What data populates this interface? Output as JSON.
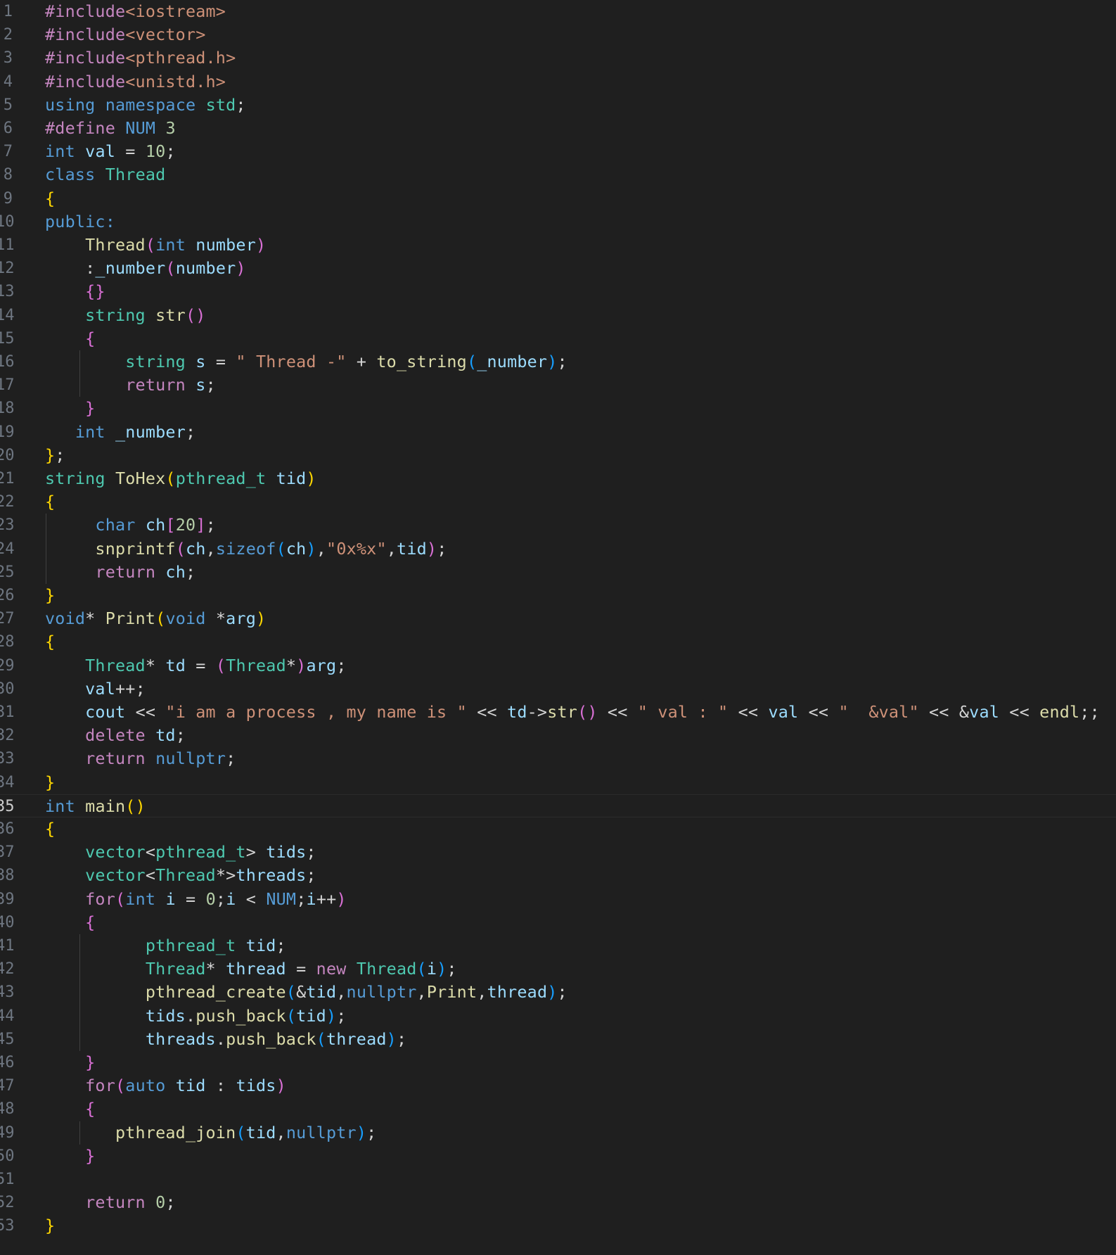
{
  "editor": {
    "theme_colors": {
      "background": "#1f1f1f",
      "preprocessor": "#c586c0",
      "keyword": "#569cd6",
      "control": "#c586c0",
      "type": "#4ec9b0",
      "function": "#dcdcaa",
      "variable": "#9cdcfe",
      "string": "#ce9178",
      "number": "#b5cea8",
      "operator": "#d4d4d4",
      "bracket_level1": "#ffd700",
      "bracket_level2": "#da70d6",
      "bracket_level3": "#179fff"
    },
    "current_line": 35,
    "line_numbers": [
      "1",
      "2",
      "3",
      "4",
      "5",
      "6",
      "7",
      "8",
      "9",
      "10",
      "11",
      "12",
      "13",
      "14",
      "15",
      "16",
      "17",
      "18",
      "19",
      "20",
      "21",
      "22",
      "23",
      "24",
      "25",
      "26",
      "27",
      "28",
      "29",
      "30",
      "31",
      "32",
      "33",
      "34",
      "35",
      "36",
      "37",
      "38",
      "39",
      "40",
      "41",
      "42",
      "43",
      "44",
      "45",
      "46",
      "47",
      "48",
      "49",
      "50",
      "51",
      "52",
      "53"
    ],
    "lines": [
      [
        [
          "pp",
          "#include"
        ],
        [
          "str",
          "<iostream>"
        ]
      ],
      [
        [
          "pp",
          "#include"
        ],
        [
          "str",
          "<vector>"
        ]
      ],
      [
        [
          "pp",
          "#include"
        ],
        [
          "str",
          "<pthread.h>"
        ]
      ],
      [
        [
          "pp",
          "#include"
        ],
        [
          "str",
          "<unistd.h>"
        ]
      ],
      [
        [
          "kw",
          "using"
        ],
        [
          "op",
          " "
        ],
        [
          "kw",
          "namespace"
        ],
        [
          "op",
          " "
        ],
        [
          "ty",
          "std"
        ],
        [
          "op",
          ";"
        ]
      ],
      [
        [
          "pp",
          "#define"
        ],
        [
          "op",
          " "
        ],
        [
          "mac",
          "NUM"
        ],
        [
          "op",
          " "
        ],
        [
          "num",
          "3"
        ]
      ],
      [
        [
          "kw",
          "int"
        ],
        [
          "op",
          " "
        ],
        [
          "var",
          "val"
        ],
        [
          "op",
          " = "
        ],
        [
          "num",
          "10"
        ],
        [
          "op",
          ";"
        ]
      ],
      [
        [
          "kw",
          "class"
        ],
        [
          "op",
          " "
        ],
        [
          "ty",
          "Thread"
        ]
      ],
      [
        [
          "b1",
          "{"
        ]
      ],
      [
        [
          "kw",
          "public:"
        ]
      ],
      [
        [
          "op",
          "    "
        ],
        [
          "fn",
          "Thread"
        ],
        [
          "b2",
          "("
        ],
        [
          "kw",
          "int"
        ],
        [
          "op",
          " "
        ],
        [
          "var",
          "number"
        ],
        [
          "b2",
          ")"
        ]
      ],
      [
        [
          "op",
          "    :"
        ],
        [
          "var",
          "_number"
        ],
        [
          "b2",
          "("
        ],
        [
          "var",
          "number"
        ],
        [
          "b2",
          ")"
        ]
      ],
      [
        [
          "op",
          "    "
        ],
        [
          "b2",
          "{}"
        ]
      ],
      [
        [
          "op",
          "    "
        ],
        [
          "ty",
          "string"
        ],
        [
          "op",
          " "
        ],
        [
          "fn",
          "str"
        ],
        [
          "b2",
          "()"
        ]
      ],
      [
        [
          "op",
          "    "
        ],
        [
          "b2",
          "{"
        ]
      ],
      [
        [
          "op",
          "        "
        ],
        [
          "ty",
          "string"
        ],
        [
          "op",
          " "
        ],
        [
          "var",
          "s"
        ],
        [
          "op",
          " = "
        ],
        [
          "str",
          "\" Thread -\""
        ],
        [
          "op",
          " + "
        ],
        [
          "fn",
          "to_string"
        ],
        [
          "b3",
          "("
        ],
        [
          "var",
          "_number"
        ],
        [
          "b3",
          ")"
        ],
        [
          "op",
          ";"
        ]
      ],
      [
        [
          "op",
          "        "
        ],
        [
          "ctrl",
          "return"
        ],
        [
          "op",
          " "
        ],
        [
          "var",
          "s"
        ],
        [
          "op",
          ";"
        ]
      ],
      [
        [
          "op",
          "    "
        ],
        [
          "b2",
          "}"
        ]
      ],
      [
        [
          "op",
          "   "
        ],
        [
          "kw",
          "int"
        ],
        [
          "op",
          " "
        ],
        [
          "var",
          "_number"
        ],
        [
          "op",
          ";"
        ]
      ],
      [
        [
          "b1",
          "}"
        ],
        [
          "op",
          ";"
        ]
      ],
      [
        [
          "ty",
          "string"
        ],
        [
          "op",
          " "
        ],
        [
          "fn",
          "ToHex"
        ],
        [
          "b1",
          "("
        ],
        [
          "ty",
          "pthread_t"
        ],
        [
          "op",
          " "
        ],
        [
          "var",
          "tid"
        ],
        [
          "b1",
          ")"
        ]
      ],
      [
        [
          "b1",
          "{"
        ]
      ],
      [
        [
          "op",
          "     "
        ],
        [
          "kw",
          "char"
        ],
        [
          "op",
          " "
        ],
        [
          "var",
          "ch"
        ],
        [
          "b2",
          "["
        ],
        [
          "num",
          "20"
        ],
        [
          "b2",
          "]"
        ],
        [
          "op",
          ";"
        ]
      ],
      [
        [
          "op",
          "     "
        ],
        [
          "fn",
          "snprintf"
        ],
        [
          "b2",
          "("
        ],
        [
          "var",
          "ch"
        ],
        [
          "op",
          ","
        ],
        [
          "kw",
          "sizeof"
        ],
        [
          "b3",
          "("
        ],
        [
          "var",
          "ch"
        ],
        [
          "b3",
          ")"
        ],
        [
          "op",
          ","
        ],
        [
          "str",
          "\"0x%x\""
        ],
        [
          "op",
          ","
        ],
        [
          "var",
          "tid"
        ],
        [
          "b2",
          ")"
        ],
        [
          "op",
          ";"
        ]
      ],
      [
        [
          "op",
          "     "
        ],
        [
          "ctrl",
          "return"
        ],
        [
          "op",
          " "
        ],
        [
          "var",
          "ch"
        ],
        [
          "op",
          ";"
        ]
      ],
      [
        [
          "b1",
          "}"
        ]
      ],
      [
        [
          "kw",
          "void"
        ],
        [
          "op",
          "* "
        ],
        [
          "fn",
          "Print"
        ],
        [
          "b1",
          "("
        ],
        [
          "kw",
          "void"
        ],
        [
          "op",
          " *"
        ],
        [
          "var",
          "arg"
        ],
        [
          "b1",
          ")"
        ]
      ],
      [
        [
          "b1",
          "{"
        ]
      ],
      [
        [
          "op",
          "    "
        ],
        [
          "ty",
          "Thread"
        ],
        [
          "op",
          "* "
        ],
        [
          "var",
          "td"
        ],
        [
          "op",
          " = "
        ],
        [
          "b2",
          "("
        ],
        [
          "ty",
          "Thread"
        ],
        [
          "op",
          "*"
        ],
        [
          "b2",
          ")"
        ],
        [
          "var",
          "arg"
        ],
        [
          "op",
          ";"
        ]
      ],
      [
        [
          "op",
          "    "
        ],
        [
          "var",
          "val"
        ],
        [
          "op",
          "++;"
        ]
      ],
      [
        [
          "op",
          "    "
        ],
        [
          "var",
          "cout"
        ],
        [
          "op",
          " << "
        ],
        [
          "str",
          "\"i am a process , my name is \""
        ],
        [
          "op",
          " << "
        ],
        [
          "var",
          "td"
        ],
        [
          "op",
          "->"
        ],
        [
          "fn",
          "str"
        ],
        [
          "b2",
          "()"
        ],
        [
          "op",
          " << "
        ],
        [
          "str",
          "\" val : \""
        ],
        [
          "op",
          " << "
        ],
        [
          "var",
          "val"
        ],
        [
          "op",
          " << "
        ],
        [
          "str",
          "\"  &val\""
        ],
        [
          "op",
          " << &"
        ],
        [
          "var",
          "val"
        ],
        [
          "op",
          " << "
        ],
        [
          "fn",
          "endl"
        ],
        [
          "op",
          ";;"
        ]
      ],
      [
        [
          "op",
          "    "
        ],
        [
          "ctrl",
          "delete"
        ],
        [
          "op",
          " "
        ],
        [
          "var",
          "td"
        ],
        [
          "op",
          ";"
        ]
      ],
      [
        [
          "op",
          "    "
        ],
        [
          "ctrl",
          "return"
        ],
        [
          "op",
          " "
        ],
        [
          "kw",
          "nullptr"
        ],
        [
          "op",
          ";"
        ]
      ],
      [
        [
          "b1",
          "}"
        ]
      ],
      [
        [
          "kw",
          "int"
        ],
        [
          "op",
          " "
        ],
        [
          "fn",
          "main"
        ],
        [
          "b1",
          "()"
        ]
      ],
      [
        [
          "b1",
          "{"
        ]
      ],
      [
        [
          "op",
          "    "
        ],
        [
          "ty",
          "vector"
        ],
        [
          "op",
          "<"
        ],
        [
          "ty",
          "pthread_t"
        ],
        [
          "op",
          "> "
        ],
        [
          "var",
          "tids"
        ],
        [
          "op",
          ";"
        ]
      ],
      [
        [
          "op",
          "    "
        ],
        [
          "ty",
          "vector"
        ],
        [
          "op",
          "<"
        ],
        [
          "ty",
          "Thread"
        ],
        [
          "op",
          "*>"
        ],
        [
          "var",
          "threads"
        ],
        [
          "op",
          ";"
        ]
      ],
      [
        [
          "op",
          "    "
        ],
        [
          "ctrl",
          "for"
        ],
        [
          "b2",
          "("
        ],
        [
          "kw",
          "int"
        ],
        [
          "op",
          " "
        ],
        [
          "var",
          "i"
        ],
        [
          "op",
          " = "
        ],
        [
          "num",
          "0"
        ],
        [
          "op",
          ";"
        ],
        [
          "var",
          "i"
        ],
        [
          "op",
          " < "
        ],
        [
          "mac",
          "NUM"
        ],
        [
          "op",
          ";"
        ],
        [
          "var",
          "i"
        ],
        [
          "op",
          "++"
        ],
        [
          "b2",
          ")"
        ]
      ],
      [
        [
          "op",
          "    "
        ],
        [
          "b2",
          "{"
        ]
      ],
      [
        [
          "op",
          "          "
        ],
        [
          "ty",
          "pthread_t"
        ],
        [
          "op",
          " "
        ],
        [
          "var",
          "tid"
        ],
        [
          "op",
          ";"
        ]
      ],
      [
        [
          "op",
          "          "
        ],
        [
          "ty",
          "Thread"
        ],
        [
          "op",
          "* "
        ],
        [
          "var",
          "thread"
        ],
        [
          "op",
          " = "
        ],
        [
          "ctrl",
          "new"
        ],
        [
          "op",
          " "
        ],
        [
          "ty",
          "Thread"
        ],
        [
          "b3",
          "("
        ],
        [
          "var",
          "i"
        ],
        [
          "b3",
          ")"
        ],
        [
          "op",
          ";"
        ]
      ],
      [
        [
          "op",
          "          "
        ],
        [
          "fn",
          "pthread_create"
        ],
        [
          "b3",
          "("
        ],
        [
          "op",
          "&"
        ],
        [
          "var",
          "tid"
        ],
        [
          "op",
          ","
        ],
        [
          "kw",
          "nullptr"
        ],
        [
          "op",
          ","
        ],
        [
          "fn",
          "Print"
        ],
        [
          "op",
          ","
        ],
        [
          "var",
          "thread"
        ],
        [
          "b3",
          ")"
        ],
        [
          "op",
          ";"
        ]
      ],
      [
        [
          "op",
          "          "
        ],
        [
          "var",
          "tids"
        ],
        [
          "op",
          "."
        ],
        [
          "fn",
          "push_back"
        ],
        [
          "b3",
          "("
        ],
        [
          "var",
          "tid"
        ],
        [
          "b3",
          ")"
        ],
        [
          "op",
          ";"
        ]
      ],
      [
        [
          "op",
          "          "
        ],
        [
          "var",
          "threads"
        ],
        [
          "op",
          "."
        ],
        [
          "fn",
          "push_back"
        ],
        [
          "b3",
          "("
        ],
        [
          "var",
          "thread"
        ],
        [
          "b3",
          ")"
        ],
        [
          "op",
          ";"
        ]
      ],
      [
        [
          "op",
          "    "
        ],
        [
          "b2",
          "}"
        ]
      ],
      [
        [
          "op",
          "    "
        ],
        [
          "ctrl",
          "for"
        ],
        [
          "b2",
          "("
        ],
        [
          "kw",
          "auto"
        ],
        [
          "op",
          " "
        ],
        [
          "var",
          "tid"
        ],
        [
          "op",
          " : "
        ],
        [
          "var",
          "tids"
        ],
        [
          "b2",
          ")"
        ]
      ],
      [
        [
          "op",
          "    "
        ],
        [
          "b2",
          "{"
        ]
      ],
      [
        [
          "op",
          "       "
        ],
        [
          "fn",
          "pthread_join"
        ],
        [
          "b3",
          "("
        ],
        [
          "var",
          "tid"
        ],
        [
          "op",
          ","
        ],
        [
          "kw",
          "nullptr"
        ],
        [
          "b3",
          ")"
        ],
        [
          "op",
          ";"
        ]
      ],
      [
        [
          "op",
          "    "
        ],
        [
          "b2",
          "}"
        ]
      ],
      [],
      [
        [
          "op",
          "    "
        ],
        [
          "ctrl",
          "return"
        ],
        [
          "op",
          " "
        ],
        [
          "num",
          "0"
        ],
        [
          "op",
          ";"
        ]
      ],
      [
        [
          "b1",
          "}"
        ]
      ]
    ]
  }
}
